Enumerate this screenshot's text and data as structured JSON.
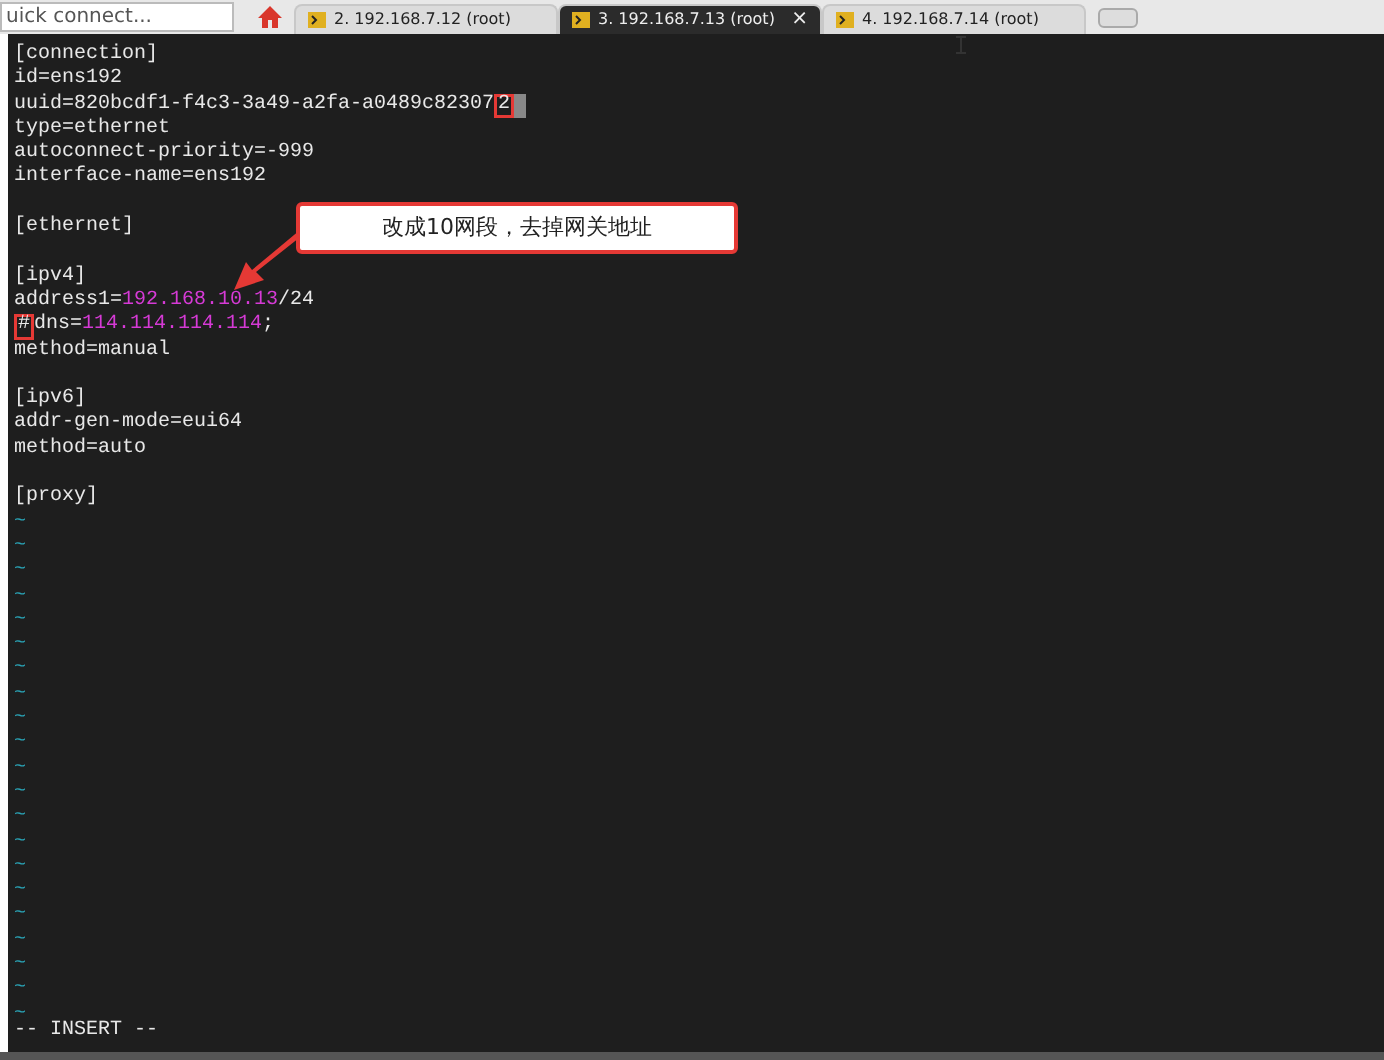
{
  "quick_connect": {
    "placeholder": "uick connect..."
  },
  "tabs": [
    {
      "label": "2. 192.168.7.12 (root)",
      "selected": false
    },
    {
      "label": "3. 192.168.7.13 (root)",
      "selected": true,
      "close": "×"
    },
    {
      "label": "4. 192.168.7.14 (root)",
      "selected": false
    }
  ],
  "editor": {
    "lines": [
      {
        "kind": "text",
        "segments": [
          {
            "text": "[connection]",
            "kind": "plain"
          }
        ]
      },
      {
        "kind": "text",
        "segments": [
          {
            "text": "id=ens192",
            "kind": "plain"
          }
        ]
      },
      {
        "kind": "text",
        "segments": [
          {
            "text": "uuid=820bcdf1-f4c3-3a49-a2fa-a0489c82307",
            "kind": "plain"
          },
          {
            "text": "2",
            "kind": "boxed"
          },
          {
            "kind": "cursor"
          }
        ]
      },
      {
        "kind": "text",
        "segments": [
          {
            "text": "type=ethernet",
            "kind": "plain"
          }
        ]
      },
      {
        "kind": "text",
        "segments": [
          {
            "text": "autoconnect-priority=-999",
            "kind": "plain"
          }
        ]
      },
      {
        "kind": "text",
        "segments": [
          {
            "text": "interface-name=ens192",
            "kind": "plain"
          }
        ]
      },
      {
        "kind": "blank"
      },
      {
        "kind": "text",
        "segments": [
          {
            "text": "[ethernet]",
            "kind": "plain"
          }
        ]
      },
      {
        "kind": "blank"
      },
      {
        "kind": "text",
        "segments": [
          {
            "text": "[ipv4]",
            "kind": "plain"
          }
        ]
      },
      {
        "kind": "text",
        "segments": [
          {
            "text": "address1=",
            "kind": "plain"
          },
          {
            "text": "192.168.10.13",
            "kind": "value"
          },
          {
            "text": "/24",
            "kind": "plain"
          }
        ]
      },
      {
        "kind": "text",
        "segments": [
          {
            "text": "#",
            "kind": "boxed"
          },
          {
            "text": "dns=",
            "kind": "plain"
          },
          {
            "text": "114.114.114.114",
            "kind": "value"
          },
          {
            "text": ";",
            "kind": "plain"
          }
        ]
      },
      {
        "kind": "text",
        "segments": [
          {
            "text": "method=manual",
            "kind": "plain"
          }
        ]
      },
      {
        "kind": "blank"
      },
      {
        "kind": "text",
        "segments": [
          {
            "text": "[ipv6]",
            "kind": "plain"
          }
        ]
      },
      {
        "kind": "text",
        "segments": [
          {
            "text": "addr-gen-mode=eui64",
            "kind": "plain"
          }
        ]
      },
      {
        "kind": "text",
        "segments": [
          {
            "text": "method=auto",
            "kind": "plain"
          }
        ]
      },
      {
        "kind": "blank"
      },
      {
        "kind": "text",
        "segments": [
          {
            "text": "[proxy]",
            "kind": "plain"
          }
        ]
      },
      {
        "kind": "text",
        "segments": [
          {
            "text": "~",
            "kind": "tilde"
          }
        ]
      },
      {
        "kind": "text",
        "segments": [
          {
            "text": "~",
            "kind": "tilde"
          }
        ]
      },
      {
        "kind": "text",
        "segments": [
          {
            "text": "~",
            "kind": "tilde"
          }
        ]
      },
      {
        "kind": "text",
        "segments": [
          {
            "text": "~",
            "kind": "tilde"
          }
        ]
      },
      {
        "kind": "text",
        "segments": [
          {
            "text": "~",
            "kind": "tilde"
          }
        ]
      },
      {
        "kind": "text",
        "segments": [
          {
            "text": "~",
            "kind": "tilde"
          }
        ]
      },
      {
        "kind": "text",
        "segments": [
          {
            "text": "~",
            "kind": "tilde"
          }
        ]
      },
      {
        "kind": "text",
        "segments": [
          {
            "text": "~",
            "kind": "tilde"
          }
        ]
      },
      {
        "kind": "text",
        "segments": [
          {
            "text": "~",
            "kind": "tilde"
          }
        ]
      },
      {
        "kind": "text",
        "segments": [
          {
            "text": "~",
            "kind": "tilde"
          }
        ]
      },
      {
        "kind": "text",
        "segments": [
          {
            "text": "~",
            "kind": "tilde"
          }
        ]
      },
      {
        "kind": "text",
        "segments": [
          {
            "text": "~",
            "kind": "tilde"
          }
        ]
      },
      {
        "kind": "text",
        "segments": [
          {
            "text": "~",
            "kind": "tilde"
          }
        ]
      },
      {
        "kind": "text",
        "segments": [
          {
            "text": "~",
            "kind": "tilde"
          }
        ]
      },
      {
        "kind": "text",
        "segments": [
          {
            "text": "~",
            "kind": "tilde"
          }
        ]
      },
      {
        "kind": "text",
        "segments": [
          {
            "text": "~",
            "kind": "tilde"
          }
        ]
      },
      {
        "kind": "text",
        "segments": [
          {
            "text": "~",
            "kind": "tilde"
          }
        ]
      },
      {
        "kind": "text",
        "segments": [
          {
            "text": "~",
            "kind": "tilde"
          }
        ]
      },
      {
        "kind": "text",
        "segments": [
          {
            "text": "~",
            "kind": "tilde"
          }
        ]
      },
      {
        "kind": "text",
        "segments": [
          {
            "text": "~",
            "kind": "tilde"
          }
        ]
      },
      {
        "kind": "text",
        "segments": [
          {
            "text": "~",
            "kind": "tilde"
          }
        ]
      }
    ],
    "mode": "-- INSERT --"
  },
  "callout": {
    "text": "改成10网段，去掉网关地址"
  }
}
